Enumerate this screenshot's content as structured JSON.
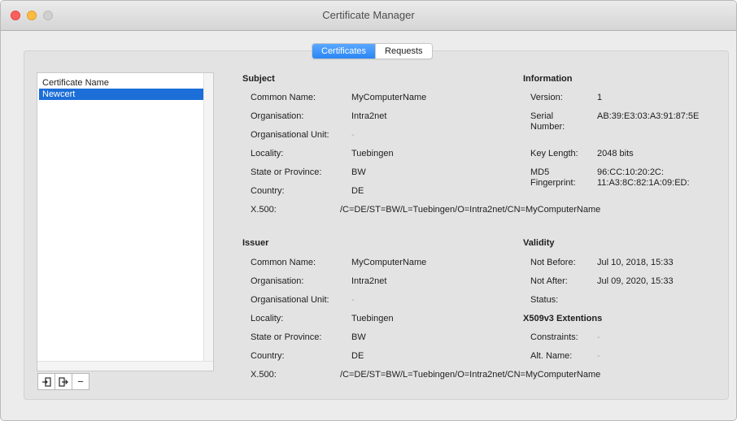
{
  "window": {
    "title": "Certificate Manager"
  },
  "tabs": [
    {
      "label": "Certificates",
      "active": true
    },
    {
      "label": "Requests",
      "active": false
    }
  ],
  "list": {
    "header": "Certificate Name",
    "items": [
      {
        "label": "Newcert",
        "selected": true
      }
    ]
  },
  "list_buttons": {
    "import_icon": "import-icon",
    "export_icon": "export-icon",
    "remove_label": "−"
  },
  "subject": {
    "title": "Subject",
    "common_name_label": "Common Name:",
    "common_name": "MyComputerName",
    "organisation_label": "Organisation:",
    "organisation": "Intra2net",
    "org_unit_label": "Organisational Unit:",
    "org_unit": "-",
    "locality_label": "Locality:",
    "locality": "Tuebingen",
    "state_label": "State or Province:",
    "state": "BW",
    "country_label": "Country:",
    "country": "DE",
    "x500_label": "X.500:",
    "x500": "/C=DE/ST=BW/L=Tuebingen/O=Intra2net/CN=MyComputerName"
  },
  "information": {
    "title": "Information",
    "version_label": "Version:",
    "version": "1",
    "serial_label_1": "Serial",
    "serial_label_2": "Number:",
    "serial": "AB:39:E3:03:A3:91:87:5E",
    "key_length_label": "Key Length:",
    "key_length": "2048 bits",
    "md5_label_1": "MD5",
    "md5_label_2": "Fingerprint:",
    "md5_line1": "96:CC:10:20:2C:",
    "md5_line2": "11:A3:8C:82:1A:09:ED:"
  },
  "issuer": {
    "title": "Issuer",
    "common_name_label": "Common Name:",
    "common_name": "MyComputerName",
    "organisation_label": "Organisation:",
    "organisation": "Intra2net",
    "org_unit_label": "Organisational Unit:",
    "org_unit": "-",
    "locality_label": "Locality:",
    "locality": "Tuebingen",
    "state_label": "State or Province:",
    "state": "BW",
    "country_label": "Country:",
    "country": "DE",
    "x500_label": "X.500:",
    "x500": "/C=DE/ST=BW/L=Tuebingen/O=Intra2net/CN=MyComputerName"
  },
  "validity": {
    "title": "Validity",
    "not_before_label": "Not Before:",
    "not_before": "Jul 10, 2018, 15:33",
    "not_after_label": "Not After:",
    "not_after": "Jul 09, 2020, 15:33",
    "status_label": "Status:",
    "status": ""
  },
  "extensions": {
    "title": "X509v3 Extentions",
    "constraints_label": "Constraints:",
    "constraints": "-",
    "alt_name_label": "Alt. Name:",
    "alt_name": "-"
  }
}
